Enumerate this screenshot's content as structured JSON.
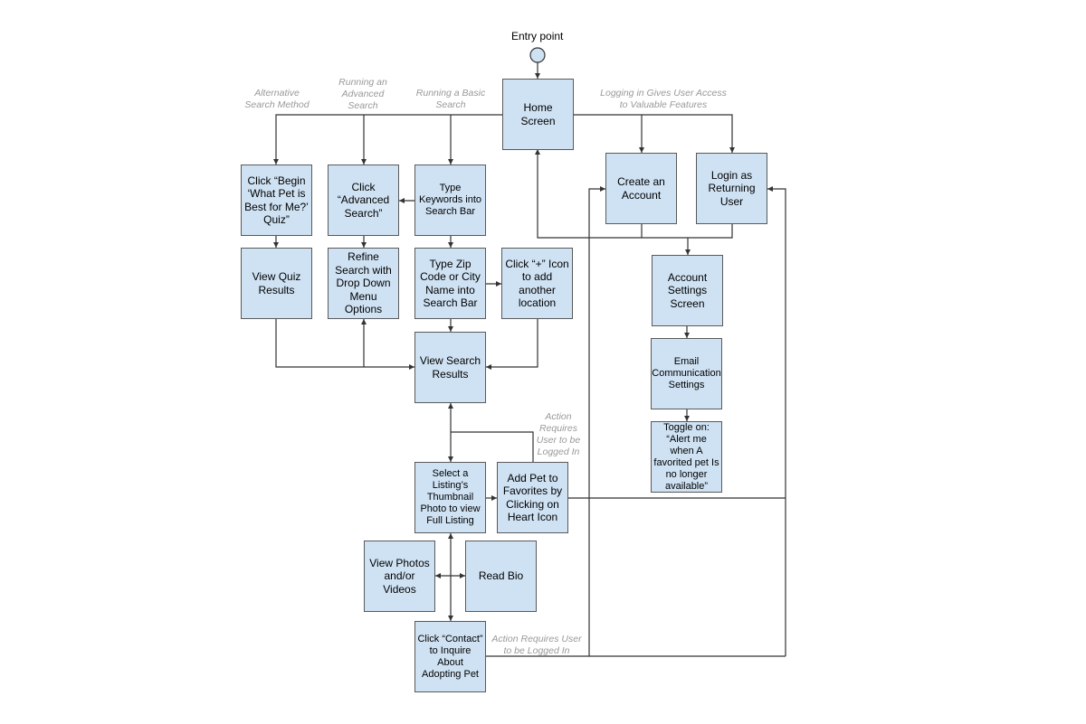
{
  "title": "Entry point",
  "nodes": {
    "home": "Home Screen",
    "quiz": "Click “Begin ‘What Pet is Best for Me?’ Quiz”",
    "advanced": "Click “Advanced Search”",
    "keywords": "Type Keywords into Search Bar",
    "create": "Create an Account",
    "login": "Login as Returning User",
    "view_quiz": "View Quiz Results",
    "refine": "Refine Search with Drop Down Menu Options",
    "zip": "Type Zip Code or City Name into Search Bar",
    "plus": "Click “+” Icon to add another location",
    "account_settings": "Account Settings Screen",
    "view_results": "View Search Results",
    "email": "Email Communication Settings",
    "toggle": "Toggle on: “Alert me when A favorited pet Is no longer available”",
    "select": "Select a Listing’s Thumbnail Photo to view Full Listing",
    "add_pet": "Add Pet to Favorites by Clicking on Heart Icon",
    "photos": "View Photos and/or Videos",
    "bio": "Read Bio",
    "contact": "Click “Contact” to Inquire About Adopting Pet"
  },
  "notes": {
    "alt": "Alternative Search Method",
    "adv": "Running an Advanced Search",
    "basic": "Running a Basic Search",
    "login": "Logging in Gives User Access to Valuable Features",
    "fav": "Action Requires User to be Logged In",
    "contact": "Action Requires User to be Logged In"
  },
  "colors": {
    "node_fill": "#cfe2f3",
    "node_border": "#595959",
    "note_text": "#999999",
    "line": "#333333"
  }
}
